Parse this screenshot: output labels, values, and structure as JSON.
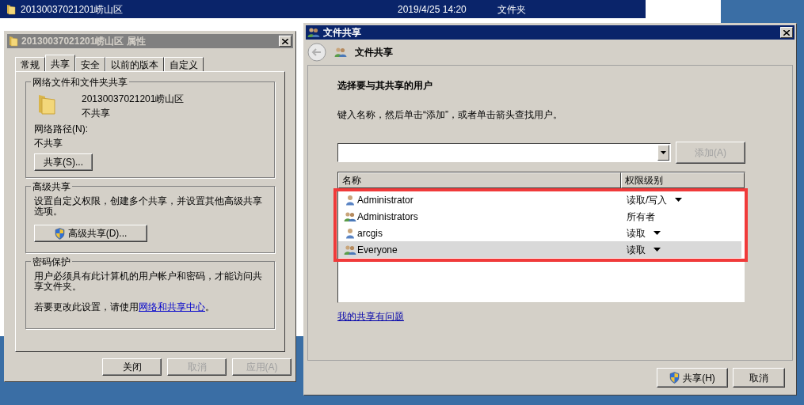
{
  "explorer_row": {
    "name": "20130037021201崂山区",
    "date": "2019/4/25 14:20",
    "type": "文件夹",
    "selected": true
  },
  "properties_dialog": {
    "title": "20130037021201崂山区 属性",
    "active": false,
    "tabs": [
      {
        "label": "常规",
        "selected": false
      },
      {
        "label": "共享",
        "selected": true
      },
      {
        "label": "安全",
        "selected": false
      },
      {
        "label": "以前的版本",
        "selected": false
      },
      {
        "label": "自定义",
        "selected": false
      }
    ],
    "network_sharing": {
      "title": "网络文件和文件夹共享",
      "folder_name": "20130037021201崂山区",
      "status": "不共享",
      "path_label": "网络路径(N):",
      "path_value": "不共享",
      "button": "共享(S)..."
    },
    "advanced_sharing": {
      "title": "高级共享",
      "description": "设置自定义权限，创建多个共享，并设置其他高级共享选项。",
      "button": "高级共享(D)..."
    },
    "password_protection": {
      "title": "密码保护",
      "description": "用户必须具有此计算机的用户帐户和密码，才能访问共享文件夹。",
      "change_prefix": "若要更改此设置，请使用",
      "link": "网络和共享中心",
      "change_suffix": "。"
    },
    "buttons": [
      {
        "label": "关闭",
        "disabled": false
      },
      {
        "label": "取消",
        "disabled": true
      },
      {
        "label": "应用(A)",
        "disabled": true
      }
    ]
  },
  "share_dialog": {
    "title": "文件共享",
    "active": true,
    "header": "文件共享",
    "heading": "选择要与其共享的用户",
    "instruction": "键入名称，然后单击“添加”，或者单击箭头查找用户。",
    "add_button": {
      "label": "添加(A)",
      "disabled": true
    },
    "columns": [
      "名称",
      "权限级别"
    ],
    "users": [
      {
        "name": "Administrator",
        "kind": "user",
        "permission": "读取/写入",
        "has_dropdown": true,
        "selected": false
      },
      {
        "name": "Administrators",
        "kind": "group",
        "permission": "所有者",
        "has_dropdown": false,
        "selected": false
      },
      {
        "name": "arcgis",
        "kind": "user",
        "permission": "读取",
        "has_dropdown": true,
        "selected": false
      },
      {
        "name": "Everyone",
        "kind": "group",
        "permission": "读取",
        "has_dropdown": true,
        "selected": true
      }
    ],
    "help_link": "我的共享有问题",
    "buttons": [
      {
        "label": "共享(H)",
        "shield": true
      },
      {
        "label": "取消",
        "shield": false
      }
    ]
  }
}
